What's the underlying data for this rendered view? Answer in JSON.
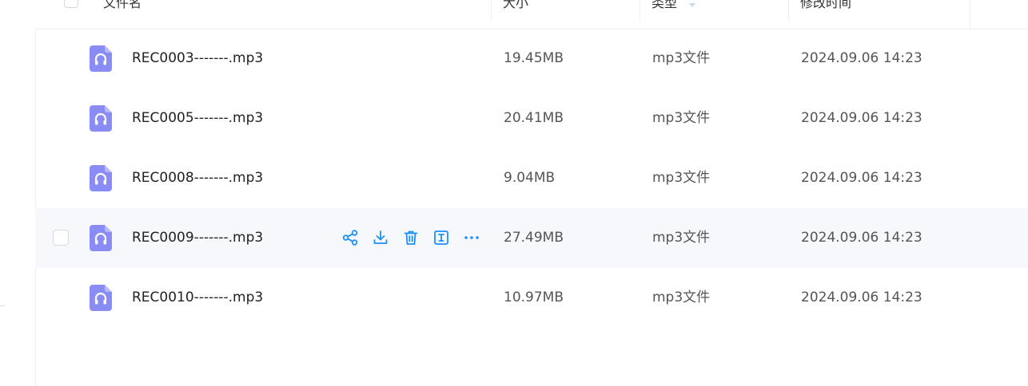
{
  "header": {
    "name_label": "文件名",
    "size_label": "大小",
    "type_label": "类型",
    "date_label": "修改时间"
  },
  "colors": {
    "accent": "#1a90ff",
    "file_icon": "#8a8cf6",
    "hover_row": "#f7f8fb"
  },
  "rows": [
    {
      "name": "REC0003-------.mp3",
      "size": "19.45MB",
      "type": "mp3文件",
      "date": "2024.09.06 14:23",
      "icon": "audio-file-icon"
    },
    {
      "name": "REC0005-------.mp3",
      "size": "20.41MB",
      "type": "mp3文件",
      "date": "2024.09.06 14:23",
      "icon": "audio-file-icon"
    },
    {
      "name": "REC0008-------.mp3",
      "size": "9.04MB",
      "type": "mp3文件",
      "date": "2024.09.06 14:23",
      "icon": "audio-file-icon"
    },
    {
      "name": "REC0009-------.mp3",
      "size": "27.49MB",
      "type": "mp3文件",
      "date": "2024.09.06 14:23",
      "icon": "audio-file-icon",
      "hovered": true,
      "actions": [
        "share-icon",
        "download-icon",
        "trash-icon",
        "rename-icon",
        "more-icon"
      ]
    },
    {
      "name": "REC0010-------.mp3",
      "size": "10.97MB",
      "type": "mp3文件",
      "date": "2024.09.06 14:23",
      "icon": "audio-file-icon"
    }
  ]
}
